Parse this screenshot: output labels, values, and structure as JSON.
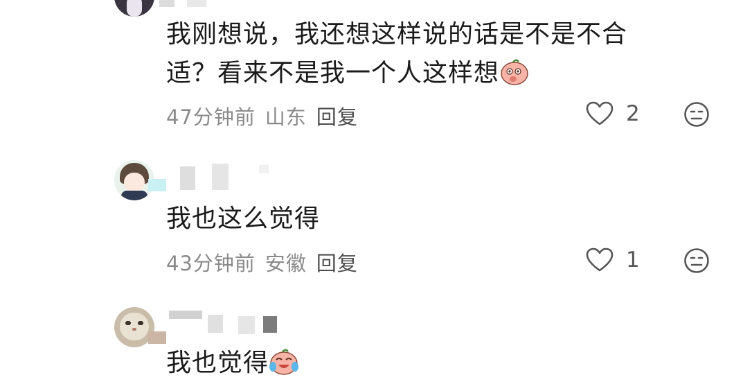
{
  "comments": [
    {
      "text_line1": "我刚想说，我还想这样说的话是不是不合",
      "text_line2": "适？看来不是我一个人这样想",
      "emoji": "shy-peach-emoji",
      "time": "47分钟前",
      "location": "山东",
      "reply_label": "回复",
      "like_count": "2"
    },
    {
      "text": "我也这么觉得",
      "time": "43分钟前",
      "location": "安徽",
      "reply_label": "回复",
      "like_count": "1"
    },
    {
      "text": "我也觉得",
      "emoji": "laughing-crying-peach-emoji"
    }
  ],
  "icons": {
    "like": "heart-outline-icon",
    "dislike": "neutral-face-icon"
  },
  "colors": {
    "meta_text": "#8a8a8a",
    "body_text": "#1b1b1b",
    "icon_stroke": "#555555",
    "emoji_peach": "#f6b1a6"
  }
}
